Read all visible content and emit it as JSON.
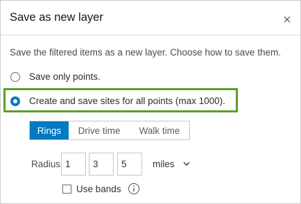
{
  "dialog": {
    "title": "Save as new layer",
    "description": "Save the filtered items as a new layer. Choose how to save them."
  },
  "options": [
    {
      "label": "Save only points.",
      "selected": false
    },
    {
      "label": "Create and save sites for all points (max 1000).",
      "selected": true
    }
  ],
  "tabs": [
    {
      "label": "Rings",
      "active": true
    },
    {
      "label": "Drive time",
      "active": false
    },
    {
      "label": "Walk time",
      "active": false
    }
  ],
  "radius": {
    "label": "Radius",
    "values": [
      "1",
      "3",
      "5"
    ],
    "unit": "miles"
  },
  "bands": {
    "label": "Use bands",
    "checked": false
  },
  "colors": {
    "accent": "#007ac2",
    "highlight": "#5a9e2a"
  },
  "icons": {
    "close": "close-icon",
    "chevron": "chevron-down-icon",
    "info": "info-icon"
  }
}
